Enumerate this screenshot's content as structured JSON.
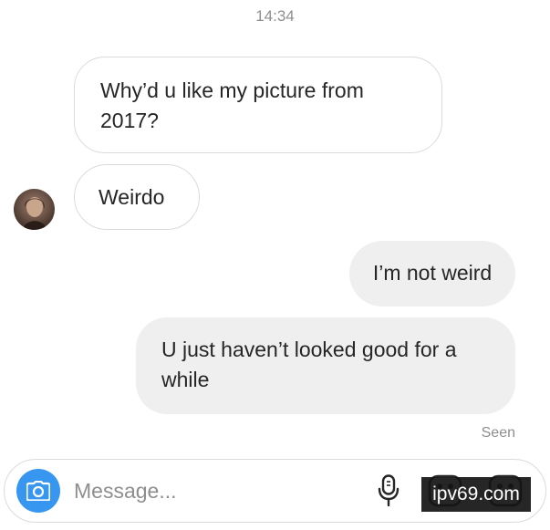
{
  "conversation": {
    "timestamp": "14:34",
    "messages": [
      {
        "direction": "received",
        "text": "Why’d u like my picture from\n2017?"
      },
      {
        "direction": "received",
        "text": "Weirdo"
      },
      {
        "direction": "sent",
        "text": "I’m not weird"
      },
      {
        "direction": "sent",
        "text": "U just haven’t looked good for a\nwhile"
      }
    ],
    "seen_label": "Seen"
  },
  "composer": {
    "placeholder": "Message...",
    "value": ""
  },
  "watermark": "ipv69.com",
  "colors": {
    "accent": "#3797f0",
    "sent_bubble": "#efefef",
    "received_border": "#dbdbdb",
    "muted_text": "#8e8e8e"
  },
  "icons": [
    "avatar",
    "camera-icon",
    "microphone-icon",
    "gallery-icon",
    "sticker-icon"
  ]
}
